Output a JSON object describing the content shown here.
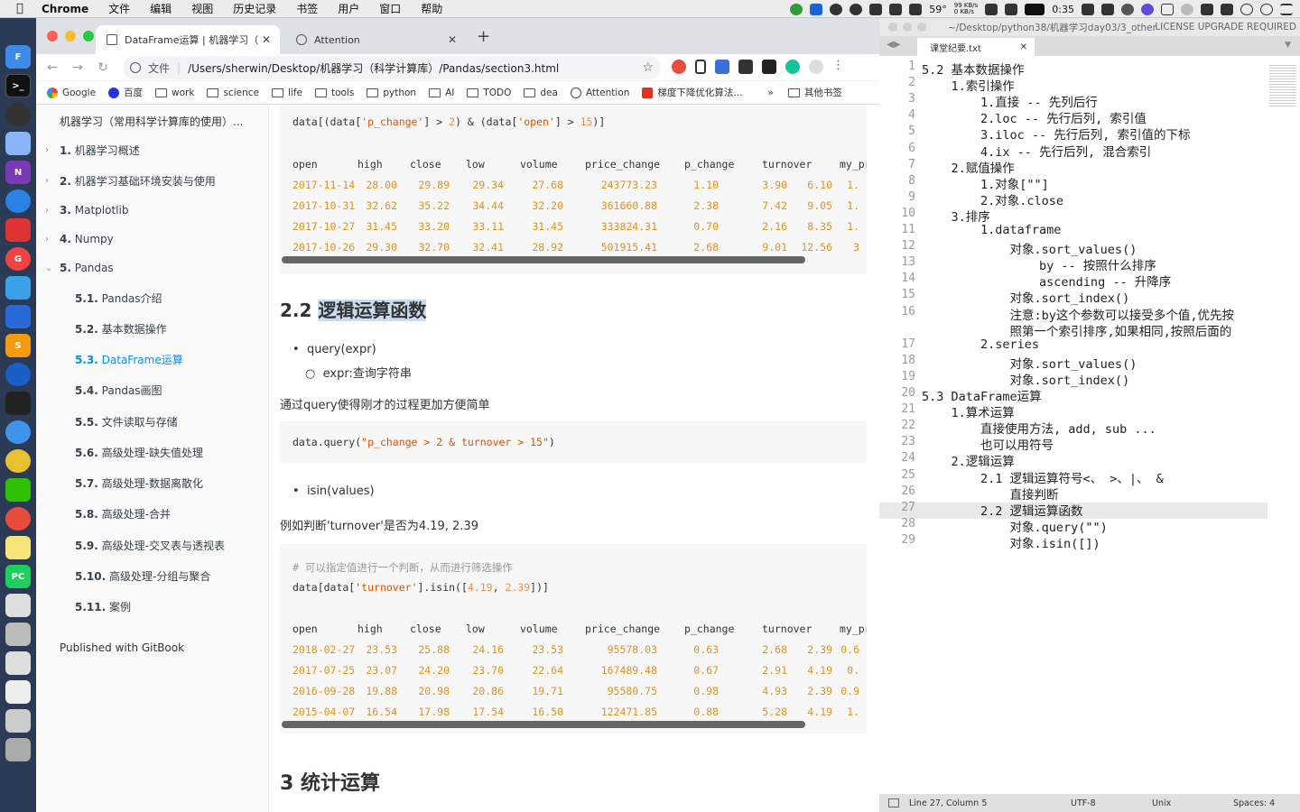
{
  "menubar": {
    "app": "Chrome",
    "menus": [
      "文件",
      "编辑",
      "视图",
      "历史记录",
      "书签",
      "用户",
      "窗口",
      "帮助"
    ],
    "weather": "59°",
    "net_up": "99 KB/s",
    "net_down": "0 KB/s",
    "battery": "0:35"
  },
  "chrome": {
    "active_tab": "DataFrame运算 | 机器学习（常",
    "inactive_tab": "Attention",
    "url_scheme": "文件",
    "url": "/Users/sherwin/Desktop/机器学习（科学计算库）/Pandas/section3.html",
    "bookmarks": [
      "Google",
      "百度",
      "work",
      "science",
      "life",
      "tools",
      "python",
      "AI",
      "TODO",
      "dea",
      "Attention",
      "梯度下降优化算法..."
    ],
    "more_bookmarks": "»",
    "other_bookmarks": "其他书签"
  },
  "sidebar": {
    "title": "机器学习（常用科学计算库的使用）...",
    "items": [
      {
        "num": "1.",
        "label": "机器学习概述"
      },
      {
        "num": "2.",
        "label": "机器学习基础环境安装与使用"
      },
      {
        "num": "3.",
        "label": "Matplotlib"
      },
      {
        "num": "4.",
        "label": "Numpy"
      },
      {
        "num": "5.",
        "label": "Pandas"
      }
    ],
    "subitems": [
      {
        "num": "5.1.",
        "label": "Pandas介绍"
      },
      {
        "num": "5.2.",
        "label": "基本数据操作"
      },
      {
        "num": "5.3.",
        "label": "DataFrame运算"
      },
      {
        "num": "5.4.",
        "label": "Pandas画图"
      },
      {
        "num": "5.5.",
        "label": "文件读取与存储"
      },
      {
        "num": "5.6.",
        "label": "高级处理-缺失值处理"
      },
      {
        "num": "5.7.",
        "label": "高级处理-数据离散化"
      },
      {
        "num": "5.8.",
        "label": "高级处理-合并"
      },
      {
        "num": "5.9.",
        "label": "高级处理-交叉表与透视表"
      },
      {
        "num": "5.10.",
        "label": "高级处理-分组与聚合"
      },
      {
        "num": "5.11.",
        "label": "案例"
      }
    ],
    "published": "Published with GitBook"
  },
  "content": {
    "code1": {
      "p1": "data[(data[",
      "s1": "'p_change'",
      "p2": "] > ",
      "n1": "2",
      "p3": ") & (data[",
      "s2": "'open'",
      "p4": "] > ",
      "n2": "15",
      "p5": ")]"
    },
    "table_headers": [
      "open",
      "high",
      "close",
      "low",
      "volume",
      "price_change",
      "p_change",
      "turnover",
      "my_pric"
    ],
    "table1": [
      [
        "2017-11-14",
        "28.00",
        "29.89",
        "29.34",
        "27.68",
        "243773.23",
        "1.10",
        "3.90",
        "6.10",
        "1."
      ],
      [
        "2017-10-31",
        "32.62",
        "35.22",
        "34.44",
        "32.20",
        "361660.88",
        "2.38",
        "7.42",
        "9.05",
        "1."
      ],
      [
        "2017-10-27",
        "31.45",
        "33.20",
        "33.11",
        "31.45",
        "333824.31",
        "0.70",
        "2.16",
        "8.35",
        "1."
      ],
      [
        "2017-10-26",
        "29.30",
        "32.70",
        "32.41",
        "28.92",
        "501915.41",
        "2.68",
        "9.01",
        "12.56",
        "3"
      ]
    ],
    "h2_num": "2.2",
    "h2_text": "逻辑运算函数",
    "bullet1": "query(expr)",
    "bullet1_sub": "expr:查询字符串",
    "para1": "通过query使得刚才的过程更加方便简单",
    "code2": {
      "p1": "data.query(",
      "s1": "\"p_change > 2 & turnover > 15\"",
      "p2": ")"
    },
    "bullet2": "isin(values)",
    "para2": "例如判断'turnover'是否为4.19, 2.39",
    "code3": {
      "comment": "# 可以指定值进行一个判断，从而进行筛选操作",
      "p1": "data[data[",
      "s1": "'turnover'",
      "p2": "].isin([",
      "n1": "4.19",
      "p3": ", ",
      "n2": "2.39",
      "p4": "])]"
    },
    "table2": [
      [
        "2018-02-27",
        "23.53",
        "25.88",
        "24.16",
        "23.53",
        "95578.03",
        "0.63",
        "2.68",
        "2.39",
        "0.6"
      ],
      [
        "2017-07-25",
        "23.07",
        "24.20",
        "23.70",
        "22.64",
        "167489.48",
        "0.67",
        "2.91",
        "4.19",
        "0."
      ],
      [
        "2016-09-28",
        "19.88",
        "20.98",
        "20.86",
        "19.71",
        "95580.75",
        "0.98",
        "4.93",
        "2.39",
        "0.9"
      ],
      [
        "2015-04-07",
        "16.54",
        "17.98",
        "17.54",
        "16.50",
        "122471.85",
        "0.88",
        "5.28",
        "4.19",
        "1."
      ]
    ],
    "h3": "3 统计运算"
  },
  "sublime": {
    "path": "~/Desktop/python38/机器学习day03/3_other",
    "license": "LICENSE UPGRADE REQUIRED",
    "tab": "课堂纪要.txt",
    "lines": [
      {
        "n": "1",
        "t": "5.2 基本数据操作"
      },
      {
        "n": "2",
        "t": "    1.索引操作"
      },
      {
        "n": "3",
        "t": "        1.直接 -- 先列后行"
      },
      {
        "n": "4",
        "t": "        2.loc -- 先行后列, 索引值"
      },
      {
        "n": "5",
        "t": "        3.iloc -- 先行后列, 索引值的下标"
      },
      {
        "n": "6",
        "t": "        4.ix -- 先行后列, 混合索引"
      },
      {
        "n": "7",
        "t": "    2.赋值操作"
      },
      {
        "n": "8",
        "t": "        1.对象[\"\"]"
      },
      {
        "n": "9",
        "t": "        2.对象.close"
      },
      {
        "n": "10",
        "t": "    3.排序"
      },
      {
        "n": "11",
        "t": "        1.dataframe"
      },
      {
        "n": "12",
        "t": "            对象.sort_values()"
      },
      {
        "n": "13",
        "t": "                by -- 按照什么排序"
      },
      {
        "n": "14",
        "t": "                ascending -- 升降序"
      },
      {
        "n": "15",
        "t": "            对象.sort_index()"
      },
      {
        "n": "16",
        "t": "            注意:by这个参数可以接受多个值,优先按"
      },
      {
        "n": "",
        "t": "            照第一个索引排序,如果相同,按照后面的"
      },
      {
        "n": "17",
        "t": "        2.series"
      },
      {
        "n": "18",
        "t": "            对象.sort_values()"
      },
      {
        "n": "19",
        "t": "            对象.sort_index()"
      },
      {
        "n": "20",
        "t": "5.3 DataFrame运算"
      },
      {
        "n": "21",
        "t": "    1.算术运算"
      },
      {
        "n": "22",
        "t": "        直接使用方法, add, sub ..."
      },
      {
        "n": "23",
        "t": "        也可以用符号"
      },
      {
        "n": "24",
        "t": "    2.逻辑运算"
      },
      {
        "n": "25",
        "t": "        2.1 逻辑运算符号<、 >、|、 &"
      },
      {
        "n": "26",
        "t": "            直接判断"
      },
      {
        "n": "27",
        "t": "        2.2 逻辑运算函数"
      },
      {
        "n": "28",
        "t": "            对象.query(\"\")"
      },
      {
        "n": "29",
        "t": "            对象.isin([])"
      }
    ],
    "status": {
      "pos": "Line 27, Column 5",
      "enc": "UTF-8",
      "eol": "Unix",
      "indent": "Spaces: 4"
    }
  }
}
